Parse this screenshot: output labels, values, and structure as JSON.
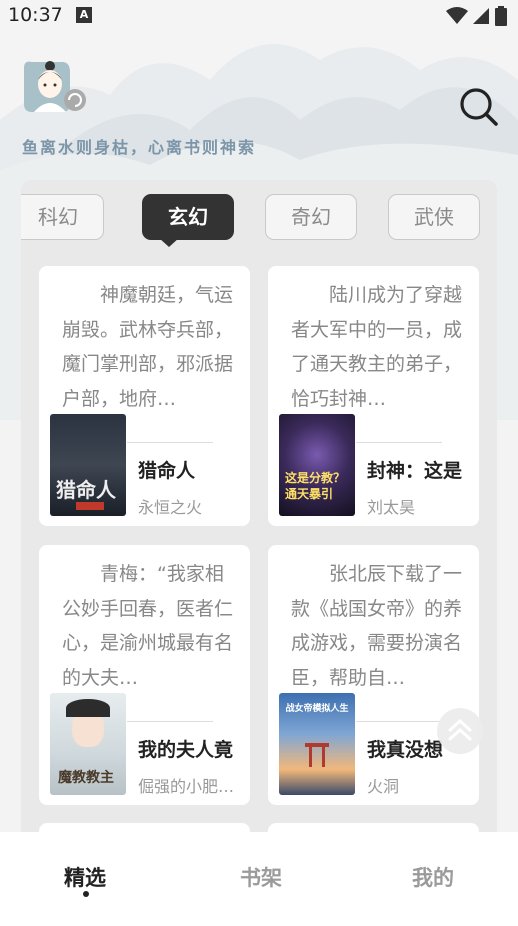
{
  "status_bar": {
    "time": "10:37",
    "notification_icon": "A"
  },
  "header": {
    "tagline": "鱼离水则身枯，心离书则神索"
  },
  "tabs": [
    {
      "label": "科幻",
      "active": false
    },
    {
      "label": "玄幻",
      "active": true
    },
    {
      "label": "奇幻",
      "active": false
    },
    {
      "label": "武侠",
      "active": false
    }
  ],
  "books": [
    {
      "description": "神魔朝廷，气运崩毁。武林夺兵部，魔门掌刑部，邪派据户部，地府…",
      "title": "猎命人",
      "author": "永恒之火",
      "cover_text": "猎命人"
    },
    {
      "description": "陆川成为了穿越者大军中的一员，成了通天教主的弟子，恰巧封神…",
      "title": "封神：这是",
      "author": "刘太昊",
      "cover_text": "这是分教？通天暴引"
    },
    {
      "description": "青梅：“我家相公妙手回春，医者仁心，是渝州城最有名的大夫…",
      "title": "我的夫人竟",
      "author": "倔强的小肥…",
      "cover_text": "魔教教主"
    },
    {
      "description": "张北辰下载了一款《战国女帝》的养成游戏，需要扮演名臣，帮助自…",
      "title": "我真没想",
      "author": "火洞",
      "cover_text": "战女帝模拟人生"
    }
  ],
  "bottom_nav": [
    {
      "label": "精选",
      "active": true
    },
    {
      "label": "书架",
      "active": false
    },
    {
      "label": "我的",
      "active": false
    }
  ]
}
